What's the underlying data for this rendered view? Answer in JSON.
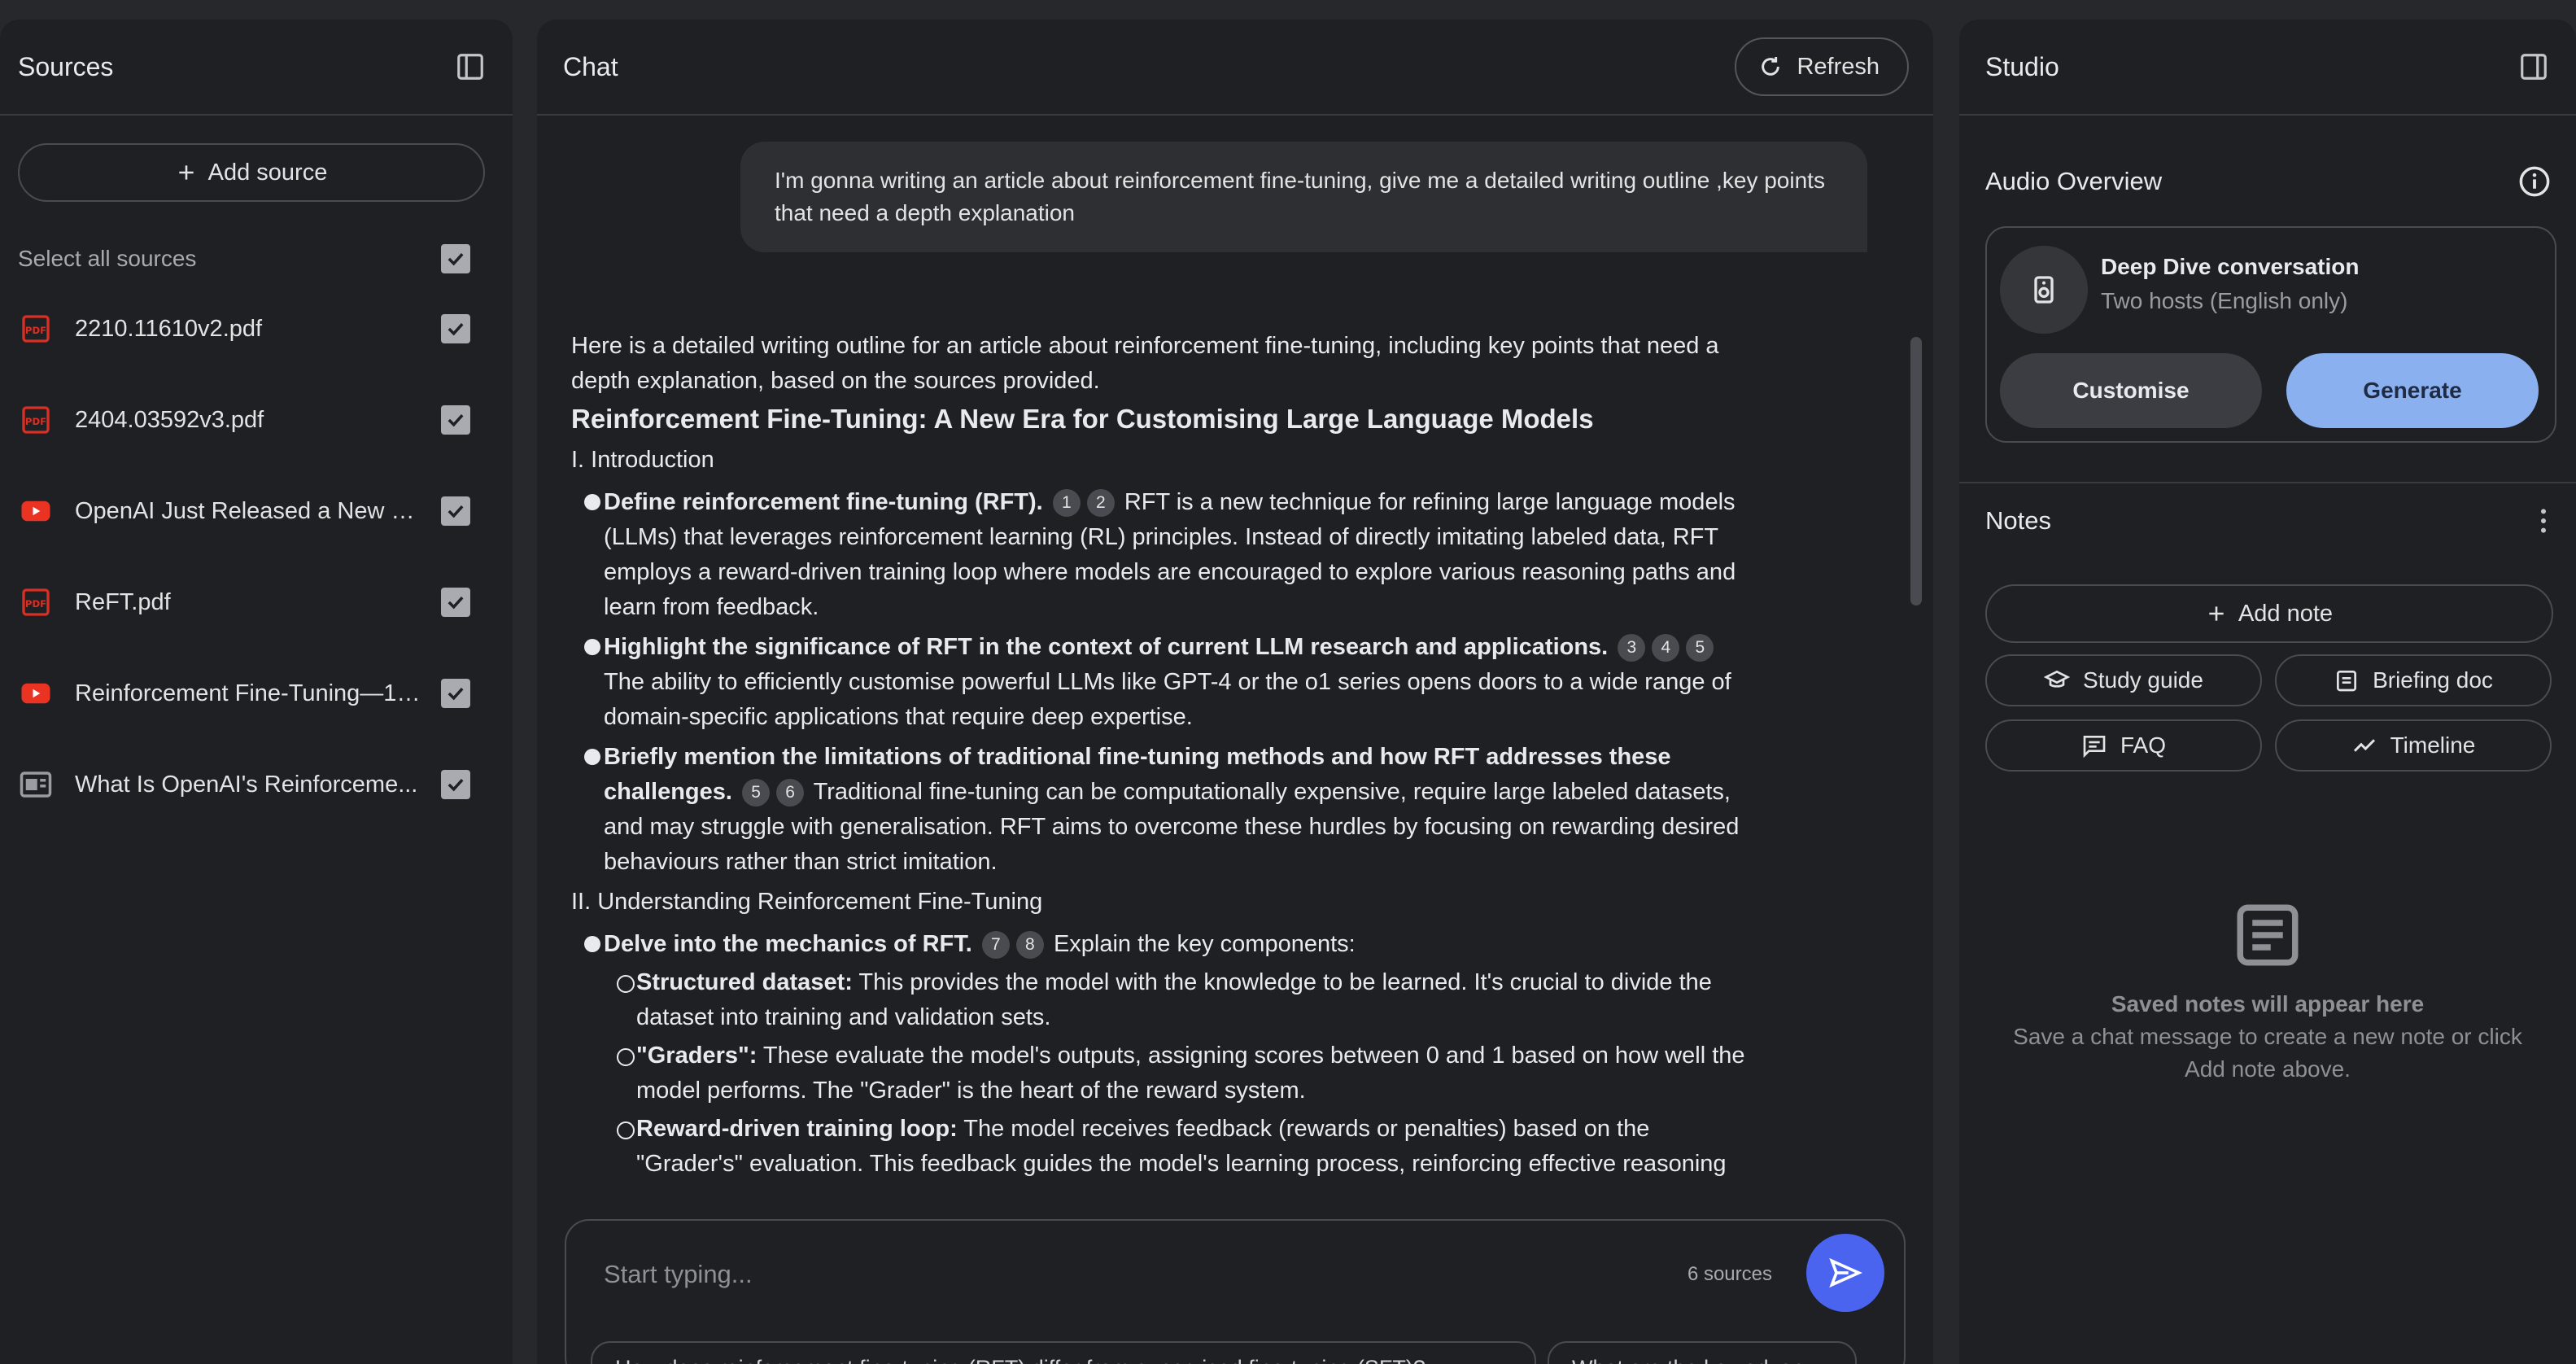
{
  "sources": {
    "title": "Sources",
    "add_label": "Add source",
    "select_all_label": "Select all sources",
    "items": [
      {
        "name": "2210.11610v2.pdf",
        "icon": "pdf-icon"
      },
      {
        "name": "2404.03592v3.pdf",
        "icon": "pdf-icon"
      },
      {
        "name": "OpenAI Just Released a New U...",
        "icon": "youtube-icon"
      },
      {
        "name": "ReFT.pdf",
        "icon": "pdf-icon"
      },
      {
        "name": "Reinforcement Fine-Tuning—12...",
        "icon": "youtube-icon"
      },
      {
        "name": "What Is OpenAI's Reinforceme...",
        "icon": "web-icon"
      }
    ]
  },
  "chat": {
    "title": "Chat",
    "refresh_label": "Refresh",
    "user_message": "I'm gonna writing an article about reinforcement fine-tuning, give me a detailed writing outline ,key points that need a depth explanation",
    "intro": "Here is a detailed writing outline for an article about reinforcement fine-tuning, including key points that need a depth explanation, based on the sources provided.",
    "heading": "Reinforcement Fine-Tuning: A New Era for Customising Large Language Models",
    "section1": "I. Introduction",
    "b1_bold": "Define reinforcement fine-tuning (RFT).",
    "b1_text": " RFT is a new technique for refining large language models (LLMs) that leverages reinforcement learning (RL) principles. Instead of directly imitating labeled data, RFT employs a reward-driven training loop where models are encouraged to explore various reasoning paths and learn from feedback.",
    "b2_bold": "Highlight the significance of RFT in the context of current LLM research and applications.",
    "b2_text": " The ability to efficiently customise powerful LLMs like GPT-4 or the o1 series opens doors to a wide range of domain-specific applications that require deep expertise.",
    "b3_bold": "Briefly mention the limitations of traditional fine-tuning methods and how RFT addresses these challenges.",
    "b3_text": " Traditional fine-tuning can be computationally expensive, require large labeled datasets, and may struggle with generalisation. RFT aims to overcome these hurdles by focusing on rewarding desired behaviours rather than strict imitation.",
    "section2": "II. Understanding Reinforcement Fine-Tuning",
    "b4_bold": "Delve into the mechanics of RFT.",
    "b4_text": " Explain the key components:",
    "s1_bold": "Structured dataset:",
    "s1_text": " This provides the model with the knowledge to be learned. It's crucial to divide the dataset into training and validation sets.",
    "s2_bold": "\"Graders\":",
    "s2_text": " These evaluate the model's outputs, assigning scores between 0 and 1 based on how well the model performs. The \"Grader\" is the heart of the reward system.",
    "s3_bold": "Reward-driven training loop:",
    "s3_text": " The model receives feedback (rewards or penalties) based on the \"Grader's\" evaluation. This feedback guides the model's learning process, reinforcing effective reasoning",
    "cites": {
      "c1": "1",
      "c2": "2",
      "c3": "3",
      "c4": "4",
      "c5": "5",
      "c6": "5",
      "c7": "6",
      "c8": "7",
      "c9": "8"
    },
    "composer_placeholder": "Start typing...",
    "sources_count": "6 sources",
    "suggestion1": "How does reinforcement fine-tuning (RFT) differ from supervised fine-tuning (SFT)?",
    "suggestion2": "What are the key advan"
  },
  "studio": {
    "title": "Studio",
    "audio_title": "Audio Overview",
    "deep_dive_title": "Deep Dive conversation",
    "deep_dive_sub": "Two hosts (English only)",
    "customise_label": "Customise",
    "generate_label": "Generate",
    "notes_title": "Notes",
    "add_note_label": "Add note",
    "study_guide_label": "Study guide",
    "briefing_label": "Briefing doc",
    "faq_label": "FAQ",
    "timeline_label": "Timeline",
    "empty_title": "Saved notes will appear here",
    "empty_text": "Save a chat message to create a new note or click Add note above."
  },
  "colors": {
    "accent": "#4a64f0",
    "generate": "#8ab0f0",
    "pdf": "#d93025",
    "youtube": "#ea3323"
  }
}
